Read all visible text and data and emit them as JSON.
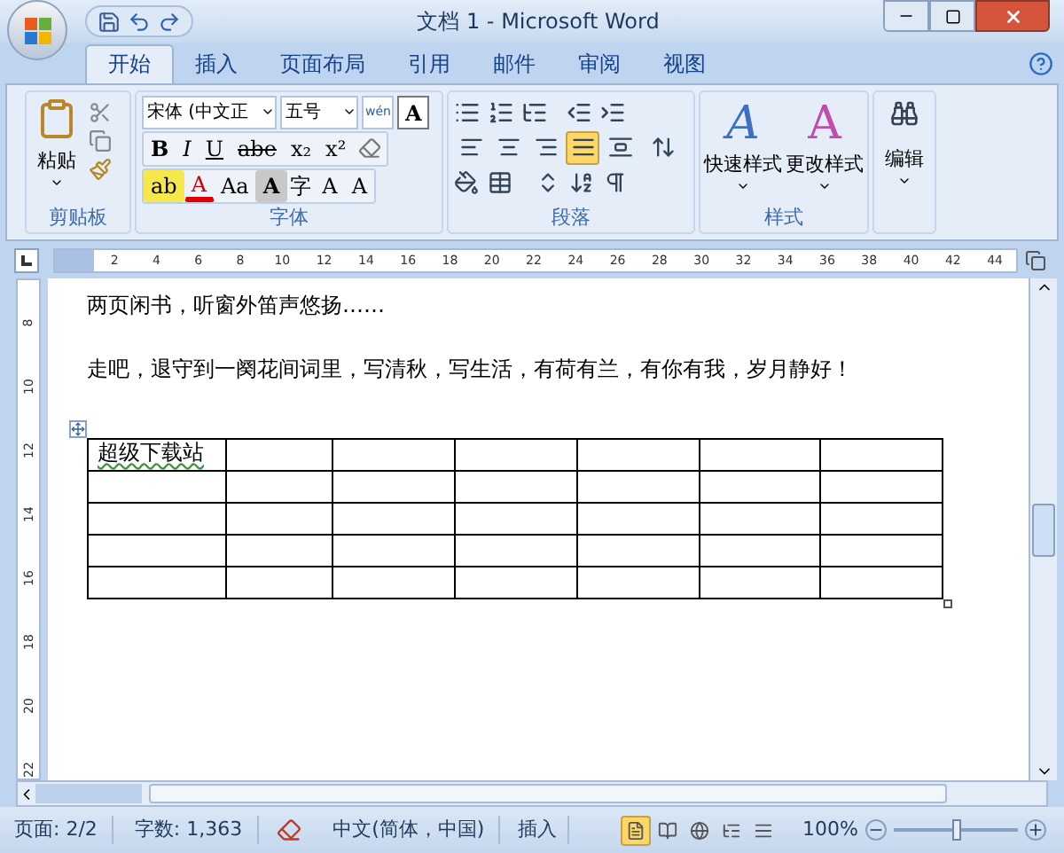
{
  "window": {
    "title": "文档 1 - Microsoft Word"
  },
  "tabs": [
    {
      "label": "开始",
      "selected": true
    },
    {
      "label": "插入",
      "selected": false
    },
    {
      "label": "页面布局",
      "selected": false
    },
    {
      "label": "引用",
      "selected": false
    },
    {
      "label": "邮件",
      "selected": false
    },
    {
      "label": "审阅",
      "selected": false
    },
    {
      "label": "视图",
      "selected": false
    }
  ],
  "clipboard": {
    "paste_label": "粘贴",
    "group_label": "剪贴板"
  },
  "font": {
    "font_name": "宋体 (中文正",
    "font_size": "五号",
    "phonetic_label": "wén",
    "border_label": "A",
    "group_label": "字体",
    "row1": [
      "B",
      "I",
      "U",
      "abe",
      "x₂",
      "x²"
    ],
    "row2": [
      "ab",
      "A",
      "Aa",
      "A",
      "字",
      "A",
      "A"
    ]
  },
  "paragraph": {
    "group_label": "段落",
    "alignments": [
      {
        "selected": false
      },
      {
        "selected": false
      },
      {
        "selected": false
      },
      {
        "selected": true
      },
      {
        "selected": false
      }
    ]
  },
  "styles": {
    "quick_icon": "A",
    "change_icon": "A",
    "quick_label": "快速样式",
    "change_label": "更改样式",
    "group_label": "样式"
  },
  "editing": {
    "label": "编辑"
  },
  "ruler": {
    "ticks": [
      "2",
      "4",
      "6",
      "8",
      "10",
      "12",
      "14",
      "16",
      "18",
      "20",
      "22",
      "24",
      "26",
      "28",
      "30",
      "32",
      "34",
      "36",
      "38",
      "40",
      "42",
      "44"
    ],
    "vertical_ticks": [
      "8",
      "10",
      "12",
      "14",
      "16",
      "18",
      "20",
      "22"
    ]
  },
  "document": {
    "paragraphs": [
      "两页闲书，听窗外笛声悠扬……",
      "走吧，退守到一阕花间词里，写清秋，写生活，有荷有兰，有你有我，岁月静好！"
    ],
    "table": {
      "rows": [
        [
          "超级下载站",
          "",
          "",
          "",
          "",
          "",
          ""
        ],
        [
          "",
          "",
          "",
          "",
          "",
          "",
          ""
        ],
        [
          "",
          "",
          "",
          "",
          "",
          "",
          ""
        ],
        [
          "",
          "",
          "",
          "",
          "",
          "",
          ""
        ],
        [
          "",
          "",
          "",
          "",
          "",
          "",
          ""
        ]
      ]
    }
  },
  "status_bar": {
    "page": "页面: 2/2",
    "words": "字数: 1,363",
    "language": "中文(简体，中国)",
    "mode": "插入",
    "zoom": "100%",
    "zoom_slider": {
      "level": 0.5
    },
    "views": [
      {
        "selected": true
      },
      {
        "selected": false
      },
      {
        "selected": false
      },
      {
        "selected": false
      },
      {
        "selected": false
      }
    ]
  }
}
